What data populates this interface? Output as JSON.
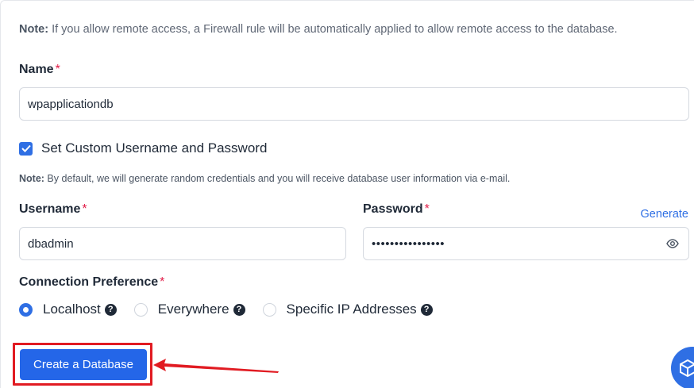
{
  "note_top": {
    "prefix": "Note:",
    "text": " If you allow remote access, a Firewall rule will be automatically applied to allow remote access to the database."
  },
  "name_field": {
    "label": "Name",
    "required_mark": "*",
    "value": "wpapplicationdb"
  },
  "custom_credentials": {
    "label": "Set Custom Username and Password",
    "checked": true
  },
  "note_credentials": {
    "prefix": "Note:",
    "text": " By default, we will generate random credentials and you will receive database user information via e-mail."
  },
  "username_field": {
    "label": "Username",
    "required_mark": "*",
    "value": "dbadmin"
  },
  "password_field": {
    "label": "Password",
    "required_mark": "*",
    "masked_value": "••••••••••••••••",
    "generate_label": "Generate"
  },
  "connection_preference": {
    "label": "Connection Preference",
    "required_mark": "*",
    "options": [
      {
        "label": "Localhost",
        "selected": true
      },
      {
        "label": "Everywhere",
        "selected": false
      },
      {
        "label": "Specific IP Addresses",
        "selected": false
      }
    ],
    "help_glyph": "?"
  },
  "submit": {
    "label": "Create a Database"
  },
  "colors": {
    "accent": "#2f6fe4",
    "button": "#2466e8",
    "required": "#e11d48",
    "annotation": "#e11b22"
  }
}
